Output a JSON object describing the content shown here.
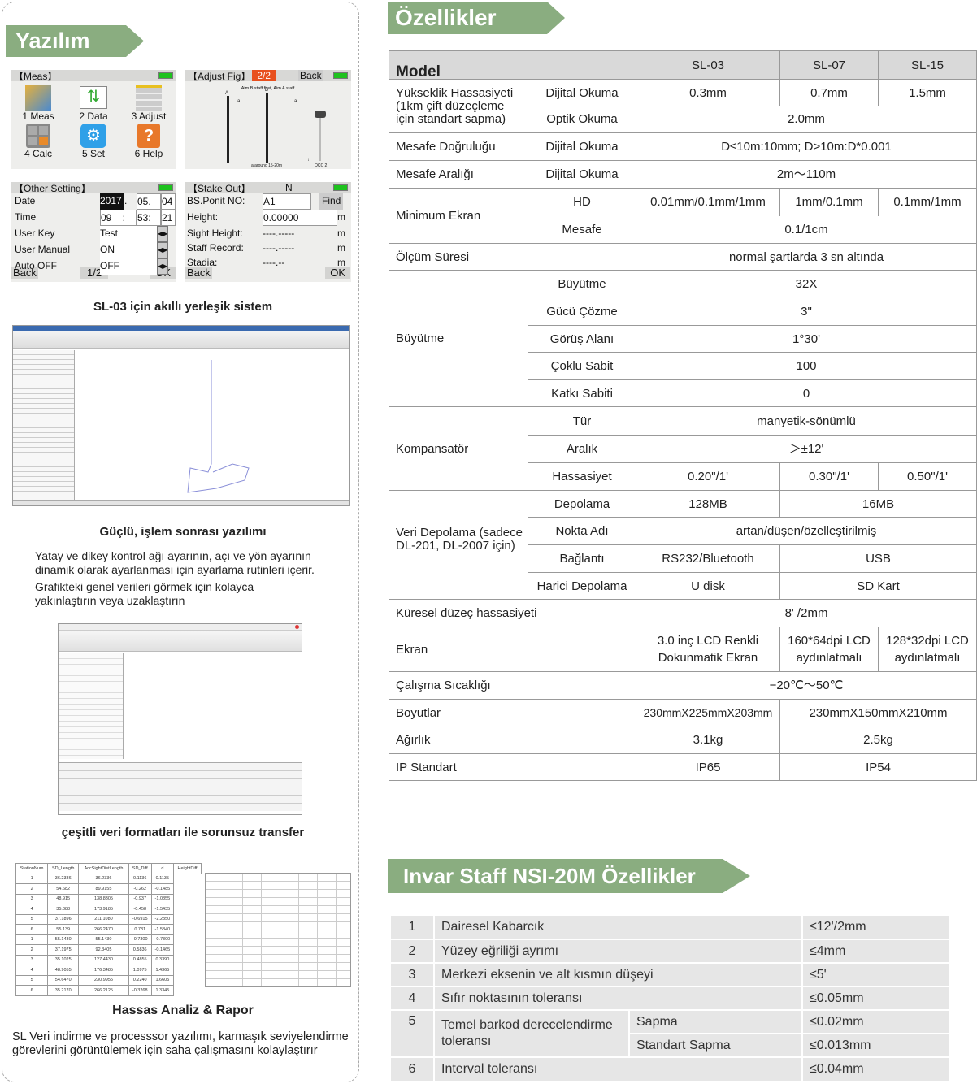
{
  "software": {
    "title": "Yazılım",
    "meas_screen": {
      "title": "【Meas】",
      "items": [
        {
          "label": "1 Meas",
          "icon": "meas-icon"
        },
        {
          "label": "2 Data",
          "icon": "data-icon"
        },
        {
          "label": "3 Adjust",
          "icon": "adjust-icon"
        },
        {
          "label": "4 Calc",
          "icon": "calculator-icon"
        },
        {
          "label": "5 Set",
          "icon": "settings-icon"
        },
        {
          "label": "6 Help",
          "icon": "help-icon"
        }
      ]
    },
    "adjust_screen": {
      "title": "【Adjust Fig】",
      "page": "2/2",
      "back": "Back",
      "instruction": "Aim B staff first,  Aim A staff",
      "staff_a": "A",
      "staff_b": "B",
      "dist_a": "a",
      "note": "a around 15-20m",
      "occ": "OCC 2"
    },
    "other_setting": {
      "title": "【Other Setting】",
      "rows": [
        {
          "label": "Date",
          "v1": "2017",
          "v2": "05.",
          "v3": "04"
        },
        {
          "label": "Time",
          "v1": "09    :",
          "v2": "53:",
          "v3": "21"
        }
      ],
      "options": [
        {
          "label": "User Key",
          "value": "Test"
        },
        {
          "label": "User Manual",
          "value": "ON"
        },
        {
          "label": "Auto OFF",
          "value": "OFF"
        }
      ],
      "back": "Back",
      "page": "1/2",
      "ok": "OK"
    },
    "stake_out": {
      "title": "【Stake Out】",
      "north": "N",
      "rows": [
        {
          "label": "BS.Ponit NO:",
          "value": "A1"
        },
        {
          "label": "Height:",
          "value": "0.00000",
          "unit": "m"
        },
        {
          "label": "Sight Height:",
          "value": "----.-----",
          "unit": "m"
        },
        {
          "label": "Staff Record:",
          "value": "----.-----",
          "unit": "m"
        },
        {
          "label": "Stadia:",
          "value": "----.--",
          "unit": "m"
        }
      ],
      "find": "Find",
      "back": "Back",
      "ok": "OK"
    },
    "caption1": "SL-03 için akıllı yerleşik sistem",
    "caption2": "Güçlü, işlem sonrası yazılımı",
    "para1": "Yatay ve dikey kontrol ağı ayarının, açı ve yön ayarının dinamik olarak ayarlanması için ayarlama rutinleri içerir.",
    "para2": "Grafikteki genel verileri görmek için kolayca yakınlaştırın veya uzaklaştırın",
    "caption3": "çeşitli veri formatları ile sorunsuz transfer",
    "report_table": {
      "headers": [
        "StationNum",
        "SD_Length",
        "AccSightDistLength",
        "SD_Diff",
        "d",
        "HeightDiff"
      ],
      "rows": [
        [
          "1",
          "36.2336",
          "36.2336",
          "0.1136",
          "0.1135"
        ],
        [
          "2",
          "54.682",
          "89.9155",
          "-0.262",
          "-0.1485"
        ],
        [
          "3",
          "48.915",
          "138.8305",
          "-0.937",
          "-1.0855"
        ],
        [
          "4",
          "35.088",
          "173.9185",
          "-0.458",
          "-1.5435"
        ],
        [
          "5",
          "37.1896",
          "211.1080",
          "-0.6915",
          "-2.2350"
        ],
        [
          "6",
          "55.139",
          "266.2470",
          "0.731",
          "-1.5840"
        ],
        [
          "1",
          "55.1430",
          "55.1430",
          "-0.7300",
          "-0.7300"
        ],
        [
          "2",
          "37.1975",
          "92.3405",
          "0.5836",
          "-0.1465"
        ],
        [
          "3",
          "35.1025",
          "127.4430",
          "0.4855",
          "0.3390"
        ],
        [
          "4",
          "48.9055",
          "176.3485",
          "1.0975",
          "1.4365"
        ],
        [
          "5",
          "54.6470",
          "230.9955",
          "0.2240",
          "1.6605"
        ],
        [
          "6",
          "35.2170",
          "266.2125",
          "-0.3268",
          "1.3345"
        ]
      ]
    },
    "caption4": "Hassas Analiz & Rapor",
    "para3": "SL Veri indirme ve processsor yazılımı, karmaşık seviyelendirme görevlerini görüntülemek için saha çalışmasını kolaylaştırır"
  },
  "specs": {
    "title": "Özellikler",
    "header": {
      "model": "Model",
      "m1": "SL-03",
      "m2": "SL-07",
      "m3": "SL-15"
    },
    "r1": {
      "label": "Yükseklik Hassasiyeti (1km çift düzeçleme için standart sapma)",
      "s1": "Dijital Okuma",
      "v1": "0.3mm",
      "v2": "0.7mm",
      "v3": "1.5mm",
      "s2": "Optik Okuma",
      "w": "2.0mm"
    },
    "r2": {
      "label": "Mesafe Doğruluğu",
      "sub": "Dijital Okuma",
      "value": "D≤10m:10mm; D>10m:D*0.001"
    },
    "r3": {
      "label": "Mesafe Aralığı",
      "sub": "Dijital Okuma",
      "value": "2m～110m"
    },
    "r4": {
      "label": "Minimum Ekran",
      "s1": "HD",
      "v1": "0.01mm/0.1mm/1mm",
      "v2": "1mm/0.1mm",
      "v3": "0.1mm/1mm",
      "s2": "Mesafe",
      "w": "0.1/1cm"
    },
    "r5": {
      "label": "Ölçüm Süresi",
      "value": "normal şartlarda 3 sn altında"
    },
    "r6": {
      "label": "Büyütme",
      "s1": "Büyütme",
      "v1": "32X",
      "s1b": "Gücü Çözme",
      "v1b": "3\"",
      "s2": "Görüş Alanı",
      "v2": "1°30'",
      "s3": "Çoklu Sabit",
      "v3": "100",
      "s4": "Katkı Sabiti",
      "v4": "0"
    },
    "r7": {
      "label": "Kompansatör",
      "s1": "Tür",
      "v1": "manyetik-sönümlü",
      "s2": "Aralık",
      "v2": "＞±12'",
      "s3": "Hassasiyet",
      "a": "0.20\"/1'",
      "b": "0.30\"/1'",
      "c": "0.50\"/1'"
    },
    "r8": {
      "label": "Veri Depolama (sadece DL-201, DL-2007 için)",
      "s1": "Depolama",
      "a1": "128MB",
      "b1": "16MB",
      "s2": "Nokta Adı",
      "v2": "artan/düşen/özelleştirilmiş",
      "s3": "Bağlantı",
      "a3": "RS232/Bluetooth",
      "b3": "USB",
      "s4": "Harici Depolama",
      "a4": "U disk",
      "b4": "SD Kart"
    },
    "r9": {
      "label": "Küresel düzeç hassasiyeti",
      "value": "8' /2mm"
    },
    "r10": {
      "label": "Ekran",
      "a": "3.0 inç LCD Renkli Dokunmatik Ekran",
      "b": "160*64dpi LCD aydınlatmalı",
      "c": "128*32dpi LCD aydınlatmalı"
    },
    "r11": {
      "label": "Çalışma Sıcaklığı",
      "value": "−20℃～50℃"
    },
    "r12": {
      "label": "Boyutlar",
      "a": "230mmX225mmX203mm",
      "b": "230mmX150mmX210mm"
    },
    "r13": {
      "label": "Ağırlık",
      "a": "3.1kg",
      "b": "2.5kg"
    },
    "r14": {
      "label": "IP Standart",
      "a": "IP65",
      "b": "IP54"
    }
  },
  "invar": {
    "title": "Invar Staff NSI-20M Özellikler",
    "rows": [
      {
        "n": "1",
        "label": "Dairesel Kabarcık",
        "value": "≤12'/2mm"
      },
      {
        "n": "2",
        "label": "Yüzey eğriliği ayrımı",
        "value": "≤4mm"
      },
      {
        "n": "3",
        "label": "Merkezi eksenin ve alt kısmın düşeyi",
        "value": "≤5'"
      },
      {
        "n": "4",
        "label": "Sıfır noktasının toleransı",
        "value": "≤0.05mm"
      },
      {
        "n": "5",
        "label": "Temel barkod derecelendirme toleransı",
        "sub1": "Sapma",
        "value1": "≤0.02mm",
        "sub2": "Standart Sapma",
        "value2": "≤0.013mm"
      },
      {
        "n": "6",
        "label": "Interval toleransı",
        "value": "≤0.04mm"
      }
    ]
  },
  "colors": {
    "banner": "#8aad80",
    "header_row": "#d9d9d9",
    "invar_row": "#e6e6e6",
    "battery": "#1ec21e",
    "page_badge": "#e8501e"
  }
}
